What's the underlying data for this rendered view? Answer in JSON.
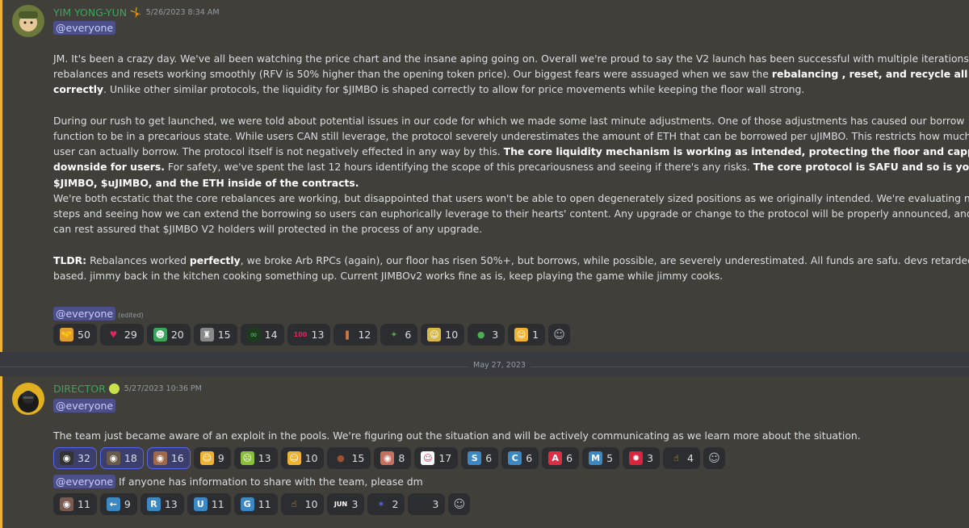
{
  "msg1": {
    "username": "YIM YONG-YUN",
    "badge": "🤸",
    "timestamp": "5/26/2023 8:34 AM",
    "mention": "@everyone",
    "lines": [
      "JM. It's been a crazy day. We've all been watching the price chart and the insane aping going on. Overall we're proud to say the V2 launch has been successful with multiple iterations of",
      "rebalances and resets working smoothly (RFV is 50% higher than the opening token price). Our biggest fears were assuaged when we saw the ",
      "rebalancing , reset, and recycle all working",
      "correctly",
      ". Unlike other similar protocols, the liquidity for $JIMBO is shaped correctly to allow for price movements while keeping the floor wall strong.",
      "During our rush to get launched, we were told about potential issues in our code for which we made some last minute adjustments. One of those adjustments has caused our borrow",
      "function to be in a precarious state. While users CAN still leverage, the protocol severely underestimates the amount of ETH that can be borrowed per uJIMBO. This restricts how much a",
      "user can actually borrow. The protocol itself is not negatively effected in any way by this. ",
      "The core liquidity mechanism is working as intended, protecting the floor and capping the",
      "downside for users.",
      " For safety, we've spent the last 12 hours identifying the scope of this precariousness and seeing if there's any risks. ",
      "The core protocol is SAFU and so is your",
      "$JIMBO, $uJIMBO, and the ETH inside of the contracts.",
      "We're both ecstatic that the core rebalances are working, but disappointed that users won't be able to open degenerately sized positions as we originally intended. We're evaluating next",
      "steps and seeing how we can extend the borrowing so users can euphorically leverage to their hearts' content. Any upgrade or change to the protocol will be properly announced, and you",
      "can rest assured that $JIMBO V2 holders will protected in the process of any upgrade.",
      "TLDR:",
      " Rebalances worked ",
      "perfectly",
      ", we broke Arb RPCs (again), our floor has risen 50%+, but borrows, while possible, are severely underestimated. All funds are safu. devs retarded but",
      "based. jimmy back in the kitchen cooking something up. Current JIMBOv2 works fine as is, keep playing the game while jimmy cooks."
    ],
    "mention2": "@everyone",
    "edited": "(edited)",
    "reactions": [
      {
        "icon": "handshake-emoji",
        "glyph": "🤝",
        "bg": "#e0a030",
        "count": "50"
      },
      {
        "icon": "heart-emoji",
        "glyph": "♥",
        "bg": "",
        "color": "#e0245e",
        "count": "29"
      },
      {
        "icon": "green-face-emoji",
        "glyph": "☻",
        "bg": "#3ba55c",
        "count": "20"
      },
      {
        "icon": "statue-emoji",
        "glyph": "♜",
        "bg": "#8a8a8a",
        "count": "15"
      },
      {
        "icon": "infinity-emoji",
        "glyph": "∞",
        "bg": "#1f3a1f",
        "color": "#3ba55c",
        "count": "14"
      },
      {
        "icon": "hundred-emoji",
        "glyph": "100",
        "bg": "",
        "color": "#e0245e",
        "count": "13"
      },
      {
        "icon": "hotdog-emoji",
        "glyph": "❚",
        "bg": "",
        "color": "#d8783a",
        "count": "12"
      },
      {
        "icon": "frog-emoji",
        "glyph": "✦",
        "bg": "",
        "color": "#5d9a4a",
        "count": "6"
      },
      {
        "icon": "cool-face-emoji",
        "glyph": "☺",
        "bg": "#d9b84a",
        "count": "10"
      },
      {
        "icon": "pepe-emoji",
        "glyph": "●",
        "bg": "",
        "color": "#4caf50",
        "count": "3"
      },
      {
        "icon": "laughing-emoji",
        "glyph": "☺",
        "bg": "#f0b232",
        "count": "1"
      }
    ]
  },
  "divider": {
    "label": "May 27, 2023"
  },
  "msg2": {
    "username": "DIRECTOR",
    "timestamp": "5/27/2023 10:36 PM",
    "mention": "@everyone",
    "text": "The team just became aware of an exploit in the pools. We're figuring out the situation and will be actively communicating as we learn more about the situation.",
    "reactions": [
      {
        "icon": "avatar-emoji-1",
        "glyph": "◉",
        "bg": "#333",
        "count": "32",
        "active": true
      },
      {
        "icon": "avatar-emoji-2",
        "glyph": "◉",
        "bg": "#6a5a4a",
        "count": "18",
        "active": true
      },
      {
        "icon": "avatar-emoji-3",
        "glyph": "◉",
        "bg": "#a06a4a",
        "count": "16",
        "active": true
      },
      {
        "icon": "thinking-emoji",
        "glyph": "☺",
        "bg": "#f0b232",
        "count": "9"
      },
      {
        "icon": "vomit-emoji",
        "glyph": "☹",
        "bg": "#8bbf3a",
        "count": "13"
      },
      {
        "icon": "laughing-emoji",
        "glyph": "☺",
        "bg": "#f0b232",
        "count": "10"
      },
      {
        "icon": "poop-emoji",
        "glyph": "●",
        "bg": "",
        "color": "#a0522d",
        "count": "15"
      },
      {
        "icon": "face-emoji",
        "glyph": "◉",
        "bg": "#c87060",
        "count": "8"
      },
      {
        "icon": "clown-emoji",
        "glyph": "☺",
        "bg": "#ffffff",
        "color": "#e0245e",
        "count": "17"
      },
      {
        "icon": "letter-s-emoji",
        "glyph": "S",
        "bg": "#3b88c3",
        "count": "6"
      },
      {
        "icon": "letter-c-emoji",
        "glyph": "C",
        "bg": "#3b88c3",
        "count": "6"
      },
      {
        "icon": "letter-a-emoji",
        "glyph": "A",
        "bg": "#dd2e44",
        "count": "6"
      },
      {
        "icon": "letter-m-emoji",
        "glyph": "M",
        "bg": "#3b88c3",
        "count": "5"
      },
      {
        "icon": "taiwan-flag-emoji",
        "glyph": "✹",
        "bg": "#d7263d",
        "count": "3"
      },
      {
        "icon": "point-up-emoji",
        "glyph": "☝",
        "bg": "",
        "color": "#f0b232",
        "count": "4"
      }
    ],
    "mention2": "@everyone",
    "followup": " If anyone has information to share with the team, please dm",
    "reactions2": [
      {
        "icon": "person-emoji",
        "glyph": "◉",
        "bg": "#7a5a50",
        "count": "11"
      },
      {
        "icon": "arrow-left-emoji",
        "glyph": "←",
        "bg": "#3b88c3",
        "count": "9"
      },
      {
        "icon": "letter-r-emoji",
        "glyph": "R",
        "bg": "#3b88c3",
        "count": "13"
      },
      {
        "icon": "letter-u-emoji",
        "glyph": "U",
        "bg": "#3b88c3",
        "count": "11"
      },
      {
        "icon": "letter-g-emoji",
        "glyph": "G",
        "bg": "#3b88c3",
        "count": "11"
      },
      {
        "icon": "middle-finger-emoji",
        "glyph": "☝",
        "bg": "",
        "color": "#f0b232",
        "count": "10"
      },
      {
        "icon": "jun-emoji",
        "glyph": "JUN",
        "bg": "",
        "color": "#ffffff",
        "count": "3"
      },
      {
        "icon": "shooting-star-emoji",
        "glyph": "✶",
        "bg": "",
        "color": "#5865f2",
        "count": "2"
      },
      {
        "icon": "blank-emoji",
        "glyph": "",
        "bg": "",
        "count": "3"
      }
    ]
  }
}
